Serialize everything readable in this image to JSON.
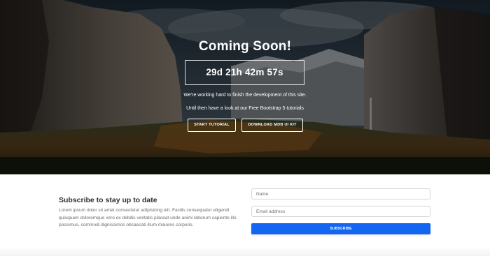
{
  "hero": {
    "title": "Coming Soon!",
    "countdown": "29d 21h 42m 57s",
    "line1": "We're working hard to finish the development of this site.",
    "line2": "Until then have a look at our Free Bootstrap 5 tutorials",
    "button1": "START TUTORIAL",
    "button2": "DOWNLOAD MDB UI KIT"
  },
  "subscribe": {
    "title": "Subscribe to stay up to date",
    "text": "Lorem ipsum dolor sit amet consectetur adipisicing elit. Facilis consequatur eligendi quisquam doloremque vero ex debitis veritatis placeat unde animi laborum sapiente illo possimus, commodi dignissimos obcaecati illum maiores corporis.",
    "name_placeholder": "Name",
    "email_placeholder": "Email address",
    "button": "SUBSCRIBE"
  },
  "colors": {
    "primary": "#1266f1"
  }
}
